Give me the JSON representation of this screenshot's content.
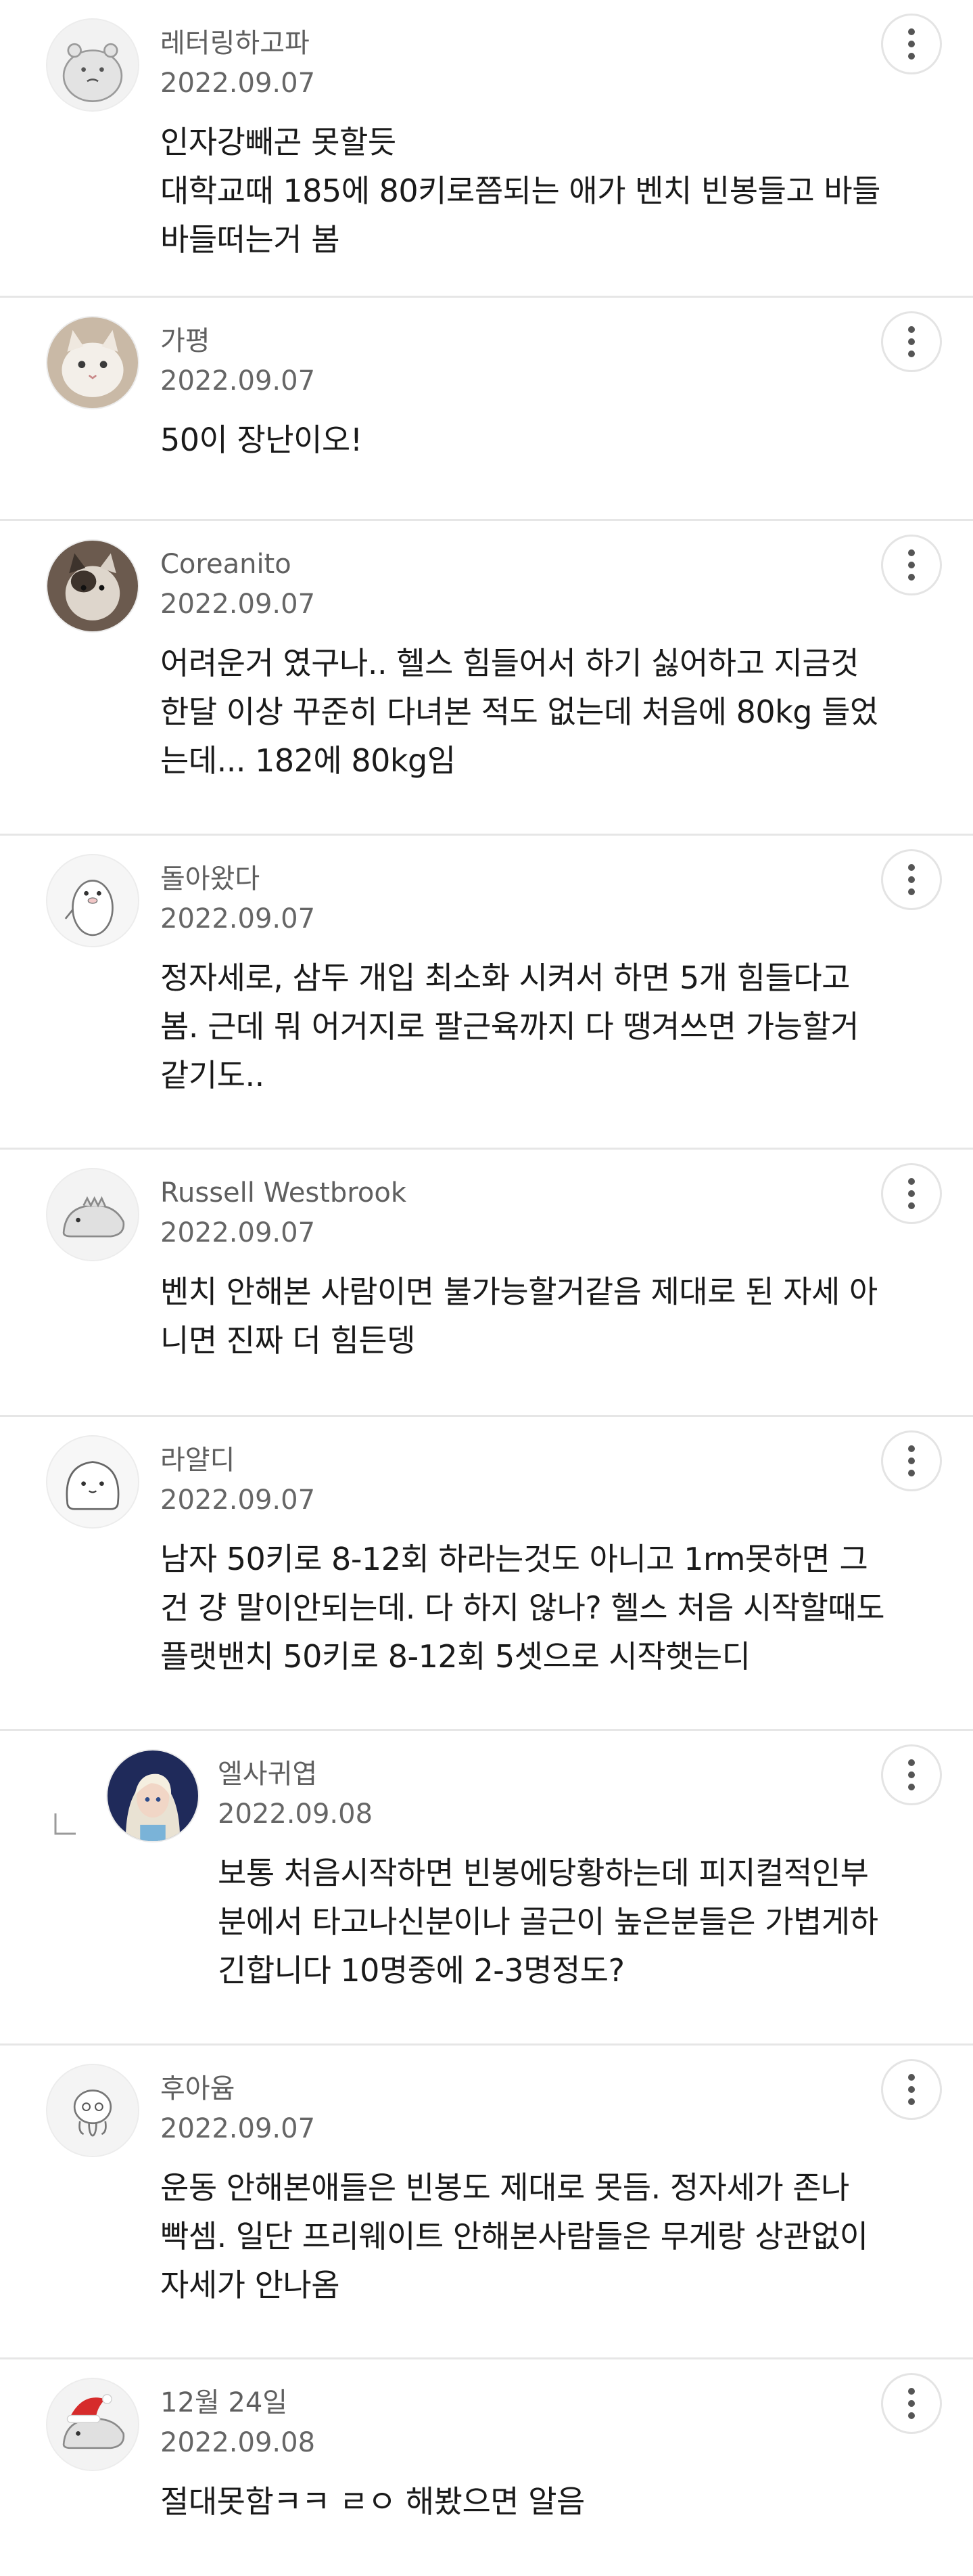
{
  "comments": [
    {
      "author": "레터링하고파",
      "date": "2022.09.07",
      "text": "인자강빼곤 못할듯\n대학교때 185에 80키로쯤되는 애가 벤치 빈봉들고 바들\n바들떠는거 봄",
      "avatar": "hippo-avatar",
      "reply": false
    },
    {
      "author": "가평",
      "date": "2022.09.07",
      "text": "50이 장난이오!",
      "avatar": "cat-photo-avatar",
      "reply": false
    },
    {
      "author": "Coreanito",
      "date": "2022.09.07",
      "text": "어려운거 였구나.. 헬스 힘들어서 하기 싫어하고 지금것\n한달 이상 꾸준히 다녀본 적도 없는데 처음에 80kg 들었\n는데... 182에 80kg임",
      "avatar": "cat-photo-avatar",
      "reply": false
    },
    {
      "author": "돌아왔다",
      "date": "2022.09.07",
      "text": "정자세로, 삼두 개입 최소화 시켜서 하면 5개 힘들다고\n봄. 근데 뭐 어거지로 팔근육까지 다 땡겨쓰면 가능할거\n같기도..",
      "avatar": "penguin-avatar",
      "reply": false
    },
    {
      "author": "Russell Westbrook",
      "date": "2022.09.07",
      "text": "벤치 안해본 사람이면 불가능할거같음 제대로 된 자세 아\n니면 진짜 더 힘든뎅",
      "avatar": "dinosaur-avatar",
      "reply": false
    },
    {
      "author": "라얄디",
      "date": "2022.09.07",
      "text": "남자 50키로 8-12회 하라는것도 아니고 1rm못하면 그\n건 걍 말이안되는데. 다 하지 않나? 헬스 처음 시작할때도\n플랫밴치 50키로 8-12회 5셋으로 시작햇는디",
      "avatar": "blob-avatar",
      "reply": false
    },
    {
      "author": "엘사귀엽",
      "date": "2022.09.08",
      "text": "보통 처음시작하면 빈봉에당황하는데 피지컬적인부\n분에서 타고나신분이나 골근이 높은분들은 가볍게하\n긴합니다 10명중에 2-3명정도?",
      "avatar": "elsa-avatar",
      "reply": true
    },
    {
      "author": "후아윰",
      "date": "2022.09.07",
      "text": "운동 안해본애들은 빈봉도 제대로 못듬. 정자세가 존나\n빡셈. 일단 프리웨이트 안해본사람들은 무게랑 상관없이\n자세가 안나옴",
      "avatar": "octopus-avatar",
      "reply": false
    },
    {
      "author": "12월 24일",
      "date": "2022.09.08",
      "text": "절대못함ㅋㅋ ㄹㅇ 해봤으면 알음",
      "avatar": "santa-dinosaur-avatar",
      "reply": false
    }
  ]
}
